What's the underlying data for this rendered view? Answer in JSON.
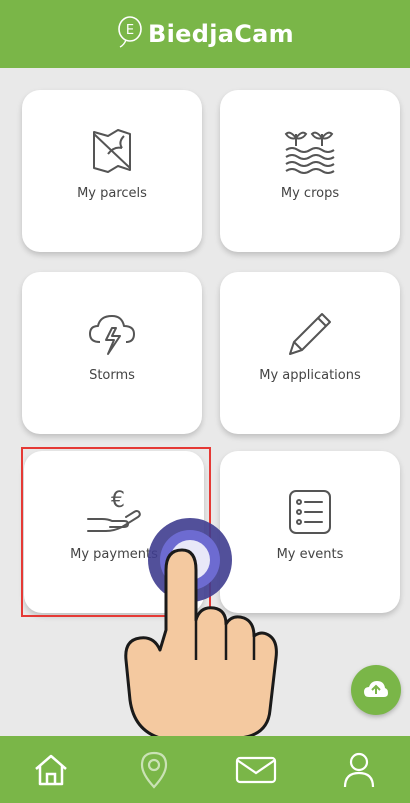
{
  "app": {
    "title": "BiedjaCam"
  },
  "tiles": [
    {
      "label": "My parcels",
      "icon": "map-icon"
    },
    {
      "label": "My crops",
      "icon": "crops-icon"
    },
    {
      "label": "Storms",
      "icon": "storm-icon"
    },
    {
      "label": "My applications",
      "icon": "pencil-icon"
    },
    {
      "label": "My payments",
      "icon": "payment-icon"
    },
    {
      "label": "My events",
      "icon": "event-list-icon"
    }
  ],
  "fab": {
    "icon": "cloud-sync-icon"
  },
  "bottom_nav": [
    {
      "icon": "home-icon"
    },
    {
      "icon": "location-icon"
    },
    {
      "icon": "mail-icon"
    },
    {
      "icon": "user-icon"
    }
  ],
  "colors": {
    "brand": "#7ab648",
    "highlight": "#e53935",
    "background": "#e9e9e9"
  }
}
